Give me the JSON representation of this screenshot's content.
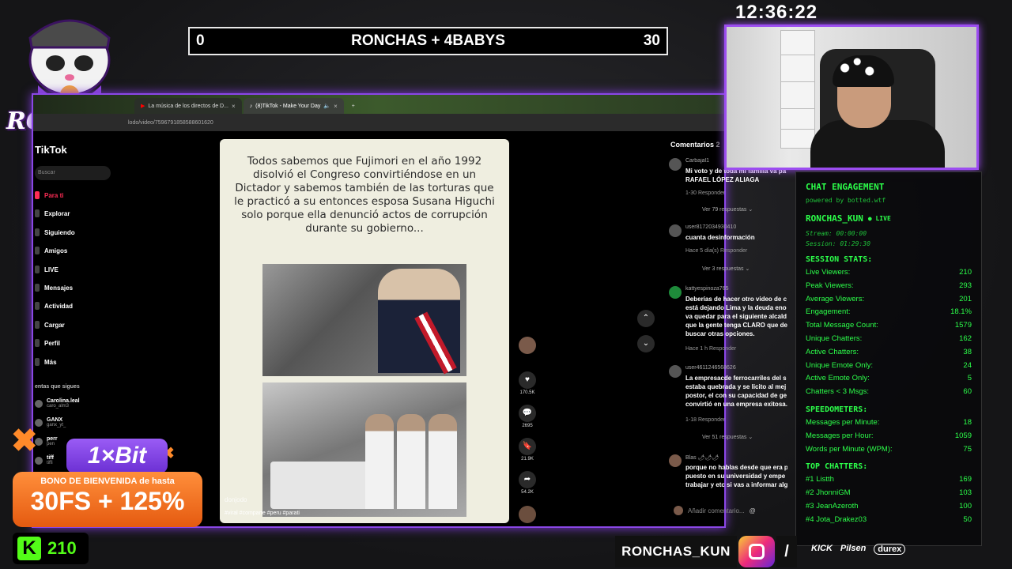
{
  "clock": "12:36:22",
  "scoreboard": {
    "left": "0",
    "title": "RONCHAS + 4BABYS",
    "right": "30"
  },
  "logo": {
    "wordmark": "RONCHAS"
  },
  "browser": {
    "tabs": [
      {
        "label": "La música de los directos de D..."
      },
      {
        "label": "(8)TikTok - Make Your Day",
        "active": true
      }
    ],
    "url": "lodo/video/7596791858588601620"
  },
  "tiktok": {
    "logo": "TikTok",
    "search_placeholder": "Buscar",
    "nav": [
      "Para ti",
      "Explorar",
      "Siguiendo",
      "Amigos",
      "LIVE",
      "Mensajes",
      "Actividad",
      "Cargar",
      "Perfil",
      "Más"
    ],
    "following_title": "entas que sigues",
    "following": [
      {
        "name": "Carolina.leal",
        "handle": "caro_alm3"
      },
      {
        "name": "GANX",
        "handle": "ganx_yt_"
      },
      {
        "name": "perr",
        "handle": "pen"
      },
      {
        "name": "tiff",
        "handle": "tiffi"
      }
    ],
    "video": {
      "text": "Todos sabemos que Fujimori en el año 1992 disolvió el Congreso convirtiéndose en un Dictador y sabemos también de las torturas que le practicó a su entonces esposa Susana Higuchi solo porque ella denunció actos de corrupción durante su gobierno...",
      "user": "donjodo",
      "tags": "#viral #comparte #peru #parati"
    },
    "actions": {
      "likes": "170.5K",
      "comments": "2695",
      "saves": "21.9K",
      "shares": "54.2K"
    },
    "comments": {
      "header": "Comentarios",
      "header_count": "2",
      "items": [
        {
          "user": "Carbajal1",
          "text": [
            "Mi voto y de toda mi familia va pa",
            "RAFAEL LÓPEZ ALIAGA"
          ],
          "meta": "1-30    Responder",
          "more": "Ver 79 respuestas ⌄"
        },
        {
          "user": "user8172034930410",
          "text": [
            "cuanta desinformación"
          ],
          "meta": "Hace 5 día(s)    Responder",
          "more": "Ver 3 respuestas ⌄"
        },
        {
          "user": "kattyespinoza765",
          "text": [
            "Deberías de hacer otro video de c",
            "está dejando Lima y la deuda eno",
            "va quedar para el siguiente alcald",
            "que la gente tenga CLARO que de",
            "buscar otras opciones."
          ],
          "meta": "Hace 1 h    Responder",
          "more": ""
        },
        {
          "user": "user4611246568626",
          "text": [
            "La empresacde ferrocarriles del s",
            "estaba quebrada y se licito al mej",
            "postor, el con su capacidad de ge",
            "convirtió en una empresa exitosa."
          ],
          "meta": "1-18    Responder",
          "more": "Ver 51 respuestas ⌄"
        },
        {
          "user": "Blas 🌶🌶🌶",
          "text": [
            "porque no hablas desde que era p",
            "puesto en su universidad y empe",
            "trabajar y etc si vas a informar alg"
          ],
          "meta": "",
          "more": ""
        }
      ],
      "add_placeholder": "Añadir comentario..."
    }
  },
  "stats": {
    "title": "CHAT ENGAGEMENT",
    "powered": "powered by botted.wtf",
    "user": "RONCHAS_KUN",
    "live": "● LIVE",
    "stream": "Stream: 00:00:00",
    "session": "Session: 01:29:30",
    "session_title": "SESSION STATS:",
    "session_rows": [
      {
        "label": "Live Viewers:",
        "value": "210"
      },
      {
        "label": "Peak Viewers:",
        "value": "293"
      },
      {
        "label": "Average Viewers:",
        "value": "201"
      },
      {
        "label": "Engagement:",
        "value": "18.1%"
      },
      {
        "label": "Total Message Count:",
        "value": "1579"
      },
      {
        "label": "Unique Chatters:",
        "value": "162"
      },
      {
        "label": "Active Chatters:",
        "value": "38"
      },
      {
        "label": "Unique Emote Only:",
        "value": "24"
      },
      {
        "label": "Active Emote Only:",
        "value": "5"
      },
      {
        "label": "Chatters < 3 Msgs:",
        "value": "60"
      }
    ],
    "speed_title": "SPEEDOMETERS:",
    "speed_rows": [
      {
        "label": "Messages per Minute:",
        "value": "18"
      },
      {
        "label": "Messages per Hour:",
        "value": "1059"
      },
      {
        "label": "Words per Minute (WPM):",
        "value": "75"
      }
    ],
    "top_title": "TOP CHATTERS:",
    "top_rows": [
      {
        "label": "#1 Listth",
        "value": "169"
      },
      {
        "label": "#2 JhonniGM",
        "value": "103"
      },
      {
        "label": "#3 JeanAzeroth",
        "value": "100"
      },
      {
        "label": "#4 Jota_Drakez03",
        "value": "50"
      }
    ]
  },
  "promo": {
    "brand": "1×Bit",
    "bonus_line": "BONO DE BIENVENIDA de hasta",
    "bonus_big": "30FS + 125%"
  },
  "kick": {
    "viewers": "210"
  },
  "bottom": {
    "name": "RONCHAS_KUN",
    "sponsors": [
      "KICK",
      "Pilsen",
      "durex"
    ]
  },
  "colors": {
    "accent": "#9c4df0",
    "stats_green": "#2cff4a",
    "tiktok_red": "#fe2c55",
    "kick_green": "#53fc18"
  }
}
